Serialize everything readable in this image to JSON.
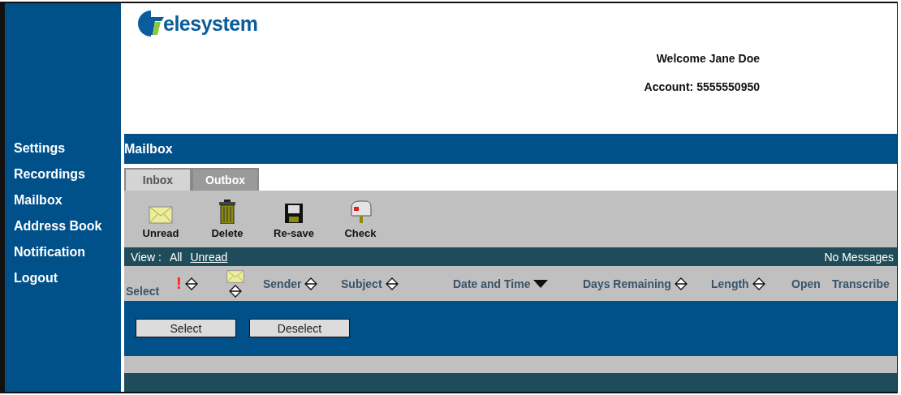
{
  "logo": {
    "text": "elesystem"
  },
  "user": {
    "welcome": "Welcome Jane Doe",
    "account": "Account: 5555550950"
  },
  "sidebar": {
    "items": [
      {
        "label": "Settings"
      },
      {
        "label": "Recordings"
      },
      {
        "label": "Mailbox"
      },
      {
        "label": "Address Book"
      },
      {
        "label": "Notification"
      },
      {
        "label": "Logout"
      }
    ]
  },
  "section_title": "Mailbox",
  "tabs": [
    {
      "label": "Inbox",
      "selected": false
    },
    {
      "label": "Outbox",
      "selected": true
    }
  ],
  "toolbar": [
    {
      "label": "Unread",
      "kind": "envelope"
    },
    {
      "label": "Delete",
      "kind": "trash"
    },
    {
      "label": "Re-save",
      "kind": "disk"
    },
    {
      "label": "Check",
      "kind": "mailbox"
    }
  ],
  "view": {
    "label": "View :",
    "options": [
      {
        "label": "All",
        "selected": true
      },
      {
        "label": "Unread",
        "selected": false
      }
    ],
    "status": "No Messages"
  },
  "columns": [
    {
      "kind": "text",
      "label": "Select",
      "sortable": false
    },
    {
      "kind": "priority",
      "label": "!",
      "sortable": true,
      "sorted": false
    },
    {
      "kind": "envelope",
      "sortable": true,
      "sorted": false
    },
    {
      "kind": "text",
      "label": "Sender",
      "sortable": true,
      "sorted": false
    },
    {
      "kind": "text",
      "label": "Subject",
      "sortable": true,
      "sorted": false
    },
    {
      "kind": "text",
      "label": "Date and Time",
      "sortable": true,
      "sorted": true
    },
    {
      "kind": "text",
      "label": "Days Remaining",
      "sortable": true,
      "sorted": false
    },
    {
      "kind": "text",
      "label": "Length",
      "sortable": true,
      "sorted": false
    },
    {
      "kind": "text",
      "label": "Open",
      "sortable": false
    },
    {
      "kind": "text",
      "label": "Transcribe",
      "sortable": false
    }
  ],
  "buttons": [
    "Select",
    "Deselect"
  ]
}
